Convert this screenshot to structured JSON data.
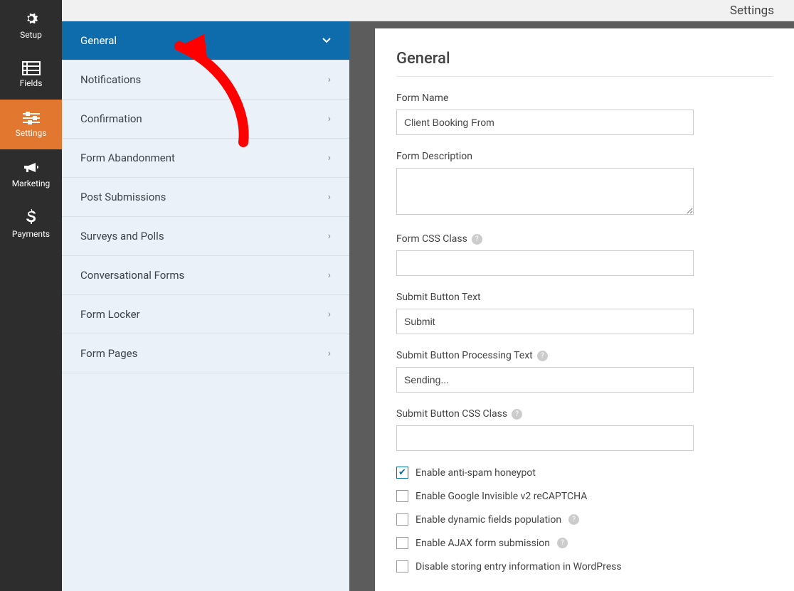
{
  "header": {
    "title": "Settings"
  },
  "leftbar": {
    "items": [
      {
        "label": "Setup",
        "icon": "gear"
      },
      {
        "label": "Fields",
        "icon": "list"
      },
      {
        "label": "Settings",
        "icon": "sliders",
        "active": true
      },
      {
        "label": "Marketing",
        "icon": "bullhorn"
      },
      {
        "label": "Payments",
        "icon": "dollar"
      }
    ]
  },
  "settings_panels": {
    "items": [
      {
        "label": "General",
        "active": true
      },
      {
        "label": "Notifications"
      },
      {
        "label": "Confirmation"
      },
      {
        "label": "Form Abandonment"
      },
      {
        "label": "Post Submissions"
      },
      {
        "label": "Surveys and Polls"
      },
      {
        "label": "Conversational Forms"
      },
      {
        "label": "Form Locker"
      },
      {
        "label": "Form Pages"
      }
    ]
  },
  "general": {
    "heading": "General",
    "form_name": {
      "label": "Form Name",
      "value": "Client Booking From"
    },
    "form_description": {
      "label": "Form Description",
      "value": ""
    },
    "form_css_class": {
      "label": "Form CSS Class",
      "value": "",
      "help": true
    },
    "submit_button_text": {
      "label": "Submit Button Text",
      "value": "Submit"
    },
    "submit_button_processing_text": {
      "label": "Submit Button Processing Text",
      "value": "Sending...",
      "help": true
    },
    "submit_button_css_class": {
      "label": "Submit Button CSS Class",
      "value": "",
      "help": true
    },
    "checkboxes": [
      {
        "label": "Enable anti-spam honeypot",
        "checked": true
      },
      {
        "label": "Enable Google Invisible v2 reCAPTCHA",
        "checked": false
      },
      {
        "label": "Enable dynamic fields population",
        "checked": false,
        "help": true
      },
      {
        "label": "Enable AJAX form submission",
        "checked": false,
        "help": true
      },
      {
        "label": "Disable storing entry information in WordPress",
        "checked": false
      }
    ]
  },
  "annotation": {
    "arrow_color": "#ff0000"
  }
}
